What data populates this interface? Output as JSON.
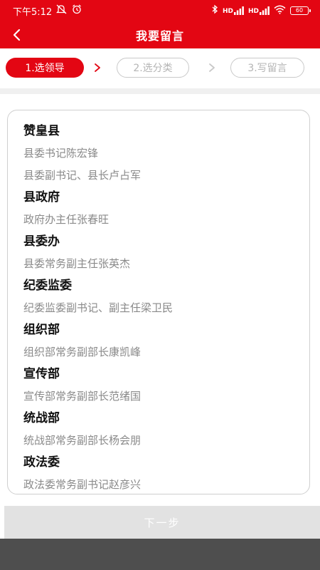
{
  "status_bar": {
    "time": "下午5:12",
    "signal1_tag": "HD",
    "signal2_tag": "HD",
    "battery": "60"
  },
  "header": {
    "title": "我要留言"
  },
  "steps": [
    {
      "label": "1.选领导",
      "active": true
    },
    {
      "label": "2.选分类",
      "active": false
    },
    {
      "label": "3.写留言",
      "active": false
    }
  ],
  "groups": [
    {
      "title": "赞皇县",
      "items": [
        "县委书记陈宏锋",
        "县委副书记、县长卢占军"
      ]
    },
    {
      "title": "县政府",
      "items": [
        "政府办主任张春旺"
      ]
    },
    {
      "title": "县委办",
      "items": [
        "县委常务副主任张英杰"
      ]
    },
    {
      "title": "纪委监委",
      "items": [
        "纪委监委副书记、副主任梁卫民"
      ]
    },
    {
      "title": "组织部",
      "items": [
        "组织部常务副部长康凯峰"
      ]
    },
    {
      "title": "宣传部",
      "items": [
        "宣传部常务副部长范绪国"
      ]
    },
    {
      "title": "统战部",
      "items": [
        "统战部常务副部长杨会朋"
      ]
    },
    {
      "title": "政法委",
      "items": [
        "政法委常务副书记赵彦兴"
      ]
    }
  ],
  "footer": {
    "next_label": "下一步"
  },
  "colors": {
    "brand": "#e30613",
    "inactive": "#b5b5b5",
    "item_text": "#8a8a8a"
  }
}
